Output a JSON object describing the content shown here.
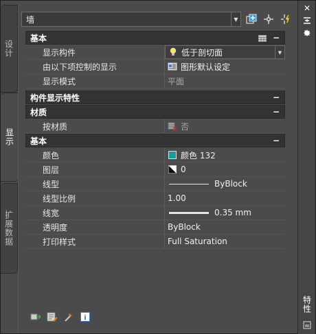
{
  "selector": {
    "value": "墙"
  },
  "tabs": {
    "design": "设计",
    "display": "显示",
    "extended": "扩展数据"
  },
  "palette_title": "特性",
  "sections": {
    "basic_top": {
      "title": "基本",
      "rows": [
        {
          "name": "显示构件",
          "value": "低于剖切面",
          "icon": "bulb-icon"
        },
        {
          "name": "由以下项控制的显示",
          "value": "图形默认设定",
          "icon": "drawing-default-icon"
        },
        {
          "name": "显示模式",
          "value": "平面"
        }
      ]
    },
    "component_props": {
      "title": "构件显示特性"
    },
    "material": {
      "title": "材质",
      "rows": [
        {
          "name": "按材质",
          "value": "否",
          "icon": "material-icon"
        }
      ]
    },
    "basic": {
      "title": "基本",
      "rows": [
        {
          "name": "颜色",
          "value": "颜色 132",
          "icon": "color-swatch"
        },
        {
          "name": "图层",
          "value": "0",
          "icon": "layer-icon"
        },
        {
          "name": "线型",
          "value": "ByBlock"
        },
        {
          "name": "线型比例",
          "value": "1.00"
        },
        {
          "name": "线宽",
          "value": "0.35 mm"
        },
        {
          "name": "透明度",
          "value": "ByBlock"
        },
        {
          "name": "打印样式",
          "value": "Full Saturation"
        }
      ]
    }
  },
  "colors": {
    "color_132": "#1a9a9a",
    "bulb": "#f5e27a"
  }
}
